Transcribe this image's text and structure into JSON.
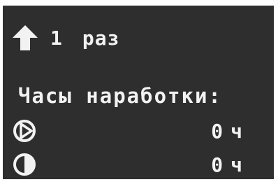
{
  "start": {
    "icon": "arrow-up-icon",
    "count": "1",
    "unit": "раз"
  },
  "hours": {
    "heading": "Часы наработки:",
    "pumps": [
      {
        "icon": "pump-icon",
        "value": "0",
        "unit": "ч"
      },
      {
        "icon": "pump-half-icon",
        "value": "0",
        "unit": "ч"
      }
    ]
  },
  "colors": {
    "background": "#2e2e2e",
    "text": "#f2f2f2"
  }
}
